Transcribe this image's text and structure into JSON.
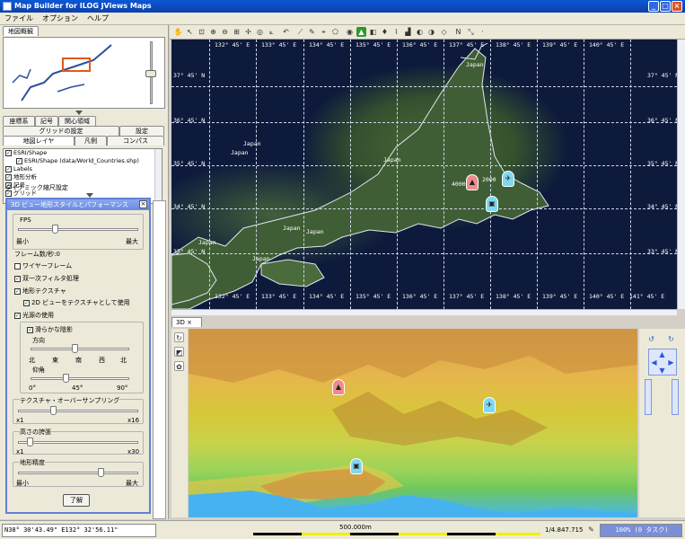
{
  "window": {
    "title": "Map Builder for ILOG JViews Maps",
    "min": "_",
    "max": "□",
    "close": "×"
  },
  "menu": [
    "ファイル",
    "オプション",
    "ヘルプ"
  ],
  "left_panel": {
    "overview_tab": "地図概観",
    "tabs_row1": [
      "座標系",
      "記号",
      "関心領域"
    ],
    "tabs_row2": [
      "グリッドの設定",
      "設定"
    ],
    "tabs_row3": [
      "地図レイヤ",
      "凡例",
      "コンパス"
    ],
    "layers": [
      {
        "label": "ESRI/Shape",
        "checked": true,
        "indent": 0
      },
      {
        "label": "ESRI/Shape (data/World_Countries.shp)",
        "checked": true,
        "indent": 1
      },
      {
        "label": "Labels",
        "checked": true,
        "indent": 0
      },
      {
        "label": "地形分析",
        "checked": true,
        "indent": 0
      },
      {
        "label": "記号",
        "checked": true,
        "indent": 0
      },
      {
        "label": "グリッド",
        "checked": true,
        "indent": 0
      }
    ],
    "dynamic_scale_label": "ダイナミック縮尺設定"
  },
  "dialog": {
    "title": "3D ビュー地形スタイルとパフォーマンス",
    "fps_label": "FPS",
    "fps_min": "最小",
    "fps_max": "最大",
    "fps_level": 0.3,
    "frame_rate": "フレーム数/秒:0",
    "checkboxes": [
      {
        "label": "ワイヤーフレーム",
        "checked": false
      },
      {
        "label": "双一次フィルタ処理",
        "checked": true
      },
      {
        "label": "地形テクスチャ",
        "checked": true
      },
      {
        "label": "2D ビューをテクスチャとして使用",
        "checked": true
      },
      {
        "label": "光源の使用",
        "checked": true
      },
      {
        "label": "滑らかな陰影",
        "checked": true
      }
    ],
    "direction_label": "方向",
    "direction_ticks": [
      "北",
      "東",
      "南",
      "西",
      "北"
    ],
    "direction_level": 0.45,
    "elevation_label": "仰角",
    "elevation_ticks": [
      "0°",
      "45°",
      "90°"
    ],
    "elevation_level": 0.35,
    "texture_label": "テクスチャ・オーバーサンプリング",
    "texture_min": "x1",
    "texture_max": "x16",
    "texture_level": 0.28,
    "height_label": "高さの誇張",
    "height_min": "x1",
    "height_max": "x30",
    "height_level": 0.08,
    "detail_label": "地形精度",
    "detail_min": "最小",
    "detail_max": "最大",
    "detail_level": 0.7,
    "ok": "了解"
  },
  "map": {
    "lon_labels": [
      "132° 45' E",
      "133° 45' E",
      "134° 45' E",
      "135° 45' E",
      "136° 45' E",
      "137° 45' E",
      "138° 45' E",
      "139° 45' E",
      "140° 45' E",
      "141° 45' E",
      "142° 45' E"
    ],
    "lat_labels": [
      "37° 45' N",
      "36° 45' N",
      "35° 45' N",
      "34° 45' N",
      "33° 45' N"
    ],
    "place_labels": [
      "Japan",
      "Japan",
      "Japan",
      "Japan",
      "Japan",
      "Japan",
      "Japan",
      "Japan"
    ],
    "elevation_labels": [
      "4000",
      "2000"
    ]
  },
  "view3d": {
    "tab": "3D"
  },
  "status": {
    "coords": "N38° 30'43.49\" E132° 32'56.11\"",
    "scale_bar": "500.000m",
    "scale": "1/4.847.715",
    "memory": "100% (0 タスク)"
  },
  "colors": {
    "accent": "#6c8ae0",
    "map_ocean": "#0e1a3c",
    "grid": "#d0d6e8"
  }
}
